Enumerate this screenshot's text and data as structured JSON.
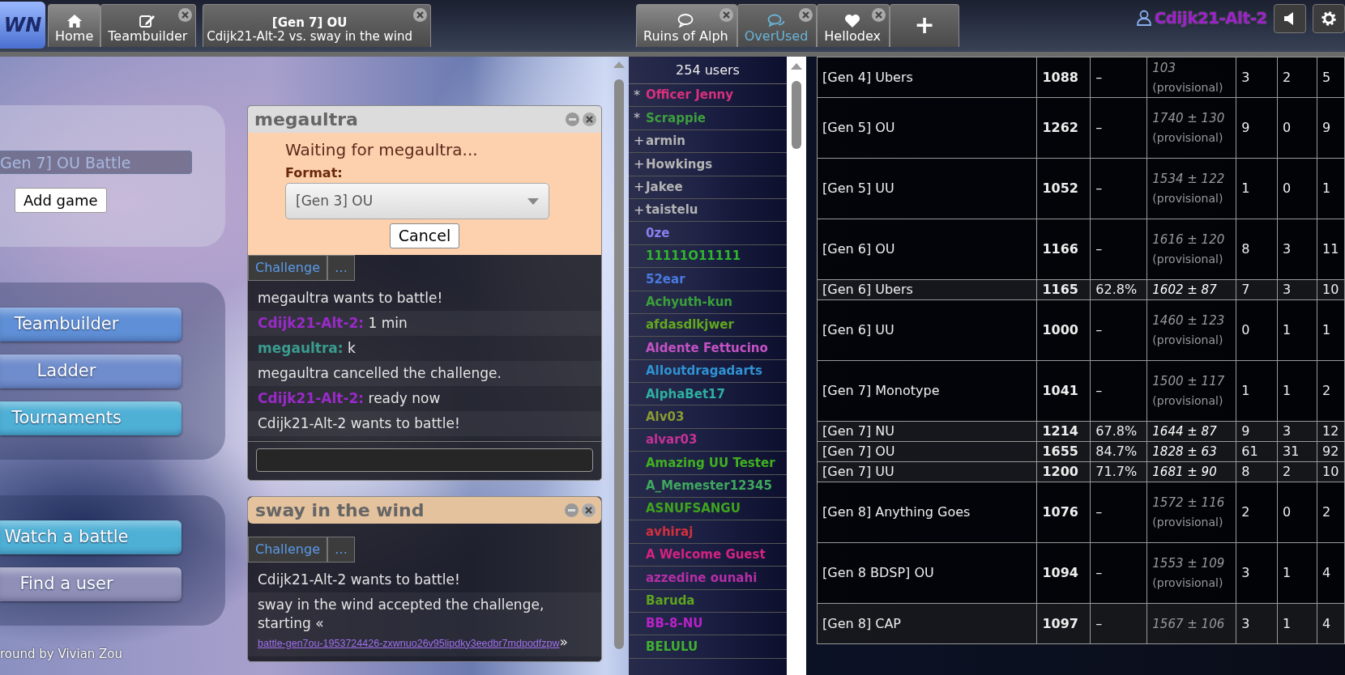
{
  "topbar": {
    "logo": "WN",
    "tabs_left": [
      {
        "kind": "home",
        "label": "Home",
        "selected": true,
        "closable": false
      },
      {
        "kind": "editor",
        "label": "Teambuilder",
        "selected": false,
        "closable": true
      },
      {
        "kind": "battle",
        "title": "[Gen 7] OU",
        "label": "Cdijk21-Alt-2 vs. sway in the wind",
        "selected": false,
        "closable": true
      }
    ],
    "tabs_right": [
      {
        "kind": "room",
        "label": "Ruins of Alph",
        "selected": true,
        "closable": true,
        "unread": false
      },
      {
        "kind": "rooms",
        "label": "OverUsed",
        "selected": false,
        "closable": true,
        "unread": true
      },
      {
        "kind": "dex",
        "label": "Hellodex",
        "selected": false,
        "closable": true,
        "unread": false
      },
      {
        "kind": "new",
        "label": "+",
        "selected": false,
        "closable": false,
        "unread": false
      }
    ],
    "username": "Cdijk21-Alt-2"
  },
  "home": {
    "search_field": {
      "value": "Gen 7] OU Battle"
    },
    "add_button": "Add game",
    "menu_groups": [
      [
        {
          "label": "Teambuilder",
          "color": "#5f8fd6"
        },
        {
          "label": "Ladder",
          "color": "#6f8ccc"
        },
        {
          "label": "Tournaments",
          "color": "#4fb0d6"
        }
      ],
      [
        {
          "label": "Watch a battle",
          "color": "#4fb0d6"
        },
        {
          "label": "Find a user",
          "color": "#8f8fb8"
        }
      ]
    ],
    "credit": "round by Vivian Zou"
  },
  "chat_windows": [
    {
      "title": "megaultra",
      "alert": false,
      "challenge": {
        "waiting": "Waiting for megaultra...",
        "format_label": "Format:",
        "format": "[Gen 3] OU",
        "cancel": "Cancel"
      },
      "buttons": [
        "Challenge",
        "…"
      ],
      "messages": [
        {
          "kind": "text",
          "text": "megaultra wants to battle!"
        },
        {
          "kind": "chat",
          "user": "Cdijk21-Alt-2:",
          "color": "#9a2ac8",
          "text": "1 min"
        },
        {
          "kind": "chat",
          "user": "megaultra:",
          "color": "#3a9c8e",
          "text": "k"
        },
        {
          "kind": "text",
          "text": "megaultra cancelled the challenge."
        },
        {
          "kind": "chat",
          "user": "Cdijk21-Alt-2:",
          "color": "#9a2ac8",
          "text": "ready now"
        },
        {
          "kind": "text",
          "text": "Cdijk21-Alt-2 wants to battle!"
        }
      ],
      "input_field": true
    },
    {
      "title": "sway in the wind",
      "alert": true,
      "buttons": [
        "Challenge",
        "…"
      ],
      "messages": [
        {
          "kind": "text",
          "text": "Cdijk21-Alt-2 wants to battle!"
        },
        {
          "kind": "link",
          "text": "sway in the wind accepted the challenge, starting «",
          "link": "battle-gen7ou-1953724426-zxwnuo26v95lipdky3eedbr7mdpodfzpw",
          "after": "»"
        }
      ],
      "input_field": false
    }
  ],
  "userlist": {
    "count": "254 users",
    "users": [
      {
        "rank": "*",
        "name": "Officer Jenny",
        "color": "#d8307c"
      },
      {
        "rank": "*",
        "name": "Scrappie",
        "color": "#3e9e3e"
      },
      {
        "rank": "+",
        "name": "armin",
        "color": "#b4b4b4"
      },
      {
        "rank": "+",
        "name": "Howkings",
        "color": "#b4b4b4"
      },
      {
        "rank": "+",
        "name": "Jakee",
        "color": "#b4b4b4"
      },
      {
        "rank": "+",
        "name": "taistelu",
        "color": "#b4b4b4"
      },
      {
        "name": "0ze",
        "color": "#8c7ef0"
      },
      {
        "name": "11111O11111",
        "color": "#2eb52e"
      },
      {
        "name": "52ear",
        "color": "#4a7ae0"
      },
      {
        "name": "Achyuth-kun",
        "color": "#3aa03a"
      },
      {
        "name": "afdasdlkjwer",
        "color": "#62a81e"
      },
      {
        "name": "Aldente Fettucino",
        "color": "#c452c4"
      },
      {
        "name": "AlIoutdragadarts",
        "color": "#2f92d2"
      },
      {
        "name": "AlphaBet17",
        "color": "#2eb0a0"
      },
      {
        "name": "Alv03",
        "color": "#8a9a32"
      },
      {
        "name": "alvar03",
        "color": "#c43296"
      },
      {
        "name": "Amazing UU Tester",
        "color": "#40b020"
      },
      {
        "name": "A_Memester12345",
        "color": "#40a85e"
      },
      {
        "name": "ASNUFSANGU",
        "color": "#3ea41e"
      },
      {
        "name": "avhiraj",
        "color": "#d2303e"
      },
      {
        "name": "A Welcome Guest",
        "color": "#d42282"
      },
      {
        "name": "azzedine ounahi",
        "color": "#b42fa6"
      },
      {
        "name": "Baruda",
        "color": "#5ea41e"
      },
      {
        "name": "BB-8-NU",
        "color": "#b822c8"
      },
      {
        "name": "BELULU",
        "color": "#40b030"
      }
    ]
  },
  "ladder": {
    "rows": [
      {
        "column_1": "[Gen 4] Ubers",
        "column_2": "1088",
        "column_3": "–",
        "column_4": "*103*",
        "provisional": true,
        "note": "(provisional)",
        "column_5": "3",
        "column_6": "2",
        "column_7": "5"
      },
      {
        "column_1": "[Gen 5] OU",
        "column_2": "1262",
        "column_3": "–",
        "column_4": "*1740* ± *130*",
        "provisional": true,
        "note": "(provisional)",
        "column_5": "9",
        "column_6": "0",
        "column_7": "9"
      },
      {
        "column_1": "[Gen 5] UU",
        "column_2": "1052",
        "column_3": "–",
        "column_4": "*1534* ± *122*",
        "provisional": true,
        "note": "(provisional)",
        "column_5": "1",
        "column_6": "0",
        "column_7": "1"
      },
      {
        "column_1": "[Gen 6] OU",
        "column_2": "1166",
        "column_3": "–",
        "column_4": "*1616* ± *120*",
        "provisional": true,
        "note": "(provisional)",
        "column_5": "8",
        "column_6": "3",
        "column_7": "11"
      },
      {
        "column_1": "[Gen 6] Ubers",
        "column_2": "1165",
        "column_3": "62.8%",
        "column_4": "*1602* ± *87*",
        "provisional": false,
        "column_5": "7",
        "column_6": "3",
        "column_7": "10"
      },
      {
        "column_1": "[Gen 6] UU",
        "column_2": "1000",
        "column_3": "–",
        "column_4": "*1460* ± *123*",
        "provisional": true,
        "note": "(provisional)",
        "column_5": "0",
        "column_6": "1",
        "column_7": "1"
      },
      {
        "column_1": "[Gen 7] Monotype",
        "column_2": "1041",
        "column_3": "–",
        "column_4": "*1500* ± *117*",
        "provisional": true,
        "note": "(provisional)",
        "column_5": "1",
        "column_6": "1",
        "column_7": "2"
      },
      {
        "column_1": "[Gen 7] NU",
        "column_2": "1214",
        "column_3": "67.8%",
        "column_4": "*1644* ± *87*",
        "provisional": false,
        "column_5": "9",
        "column_6": "3",
        "column_7": "12"
      },
      {
        "column_1": "[Gen 7] OU",
        "column_2": "1655",
        "column_3": "84.7%",
        "column_4": "*1828* ± *63*",
        "provisional": false,
        "column_5": "61",
        "column_6": "31",
        "column_7": "92"
      },
      {
        "column_1": "[Gen 7] UU",
        "column_2": "1200",
        "column_3": "71.7%",
        "column_4": "*1681* ± *90*",
        "provisional": false,
        "column_5": "8",
        "column_6": "2",
        "column_7": "10"
      },
      {
        "column_1": "[Gen 8] Anything Goes",
        "column_2": "1076",
        "column_3": "–",
        "column_4": "*1572* ± *116*",
        "provisional": true,
        "note": "(provisional)",
        "column_5": "2",
        "column_6": "0",
        "column_7": "2"
      },
      {
        "column_1": "[Gen 8 BDSP] OU",
        "column_2": "1094",
        "column_3": "–",
        "column_4": "*1553* ± *109*",
        "provisional": true,
        "note": "(provisional)",
        "column_5": "3",
        "column_6": "1",
        "column_7": "4"
      },
      {
        "column_1": "[Gen 8] CAP",
        "column_2": "1097",
        "column_3": "–",
        "column_4": "*1567* ± *106*",
        "provisional": true,
        "column_5": "3",
        "column_6": "1",
        "column_7": "4"
      }
    ]
  }
}
